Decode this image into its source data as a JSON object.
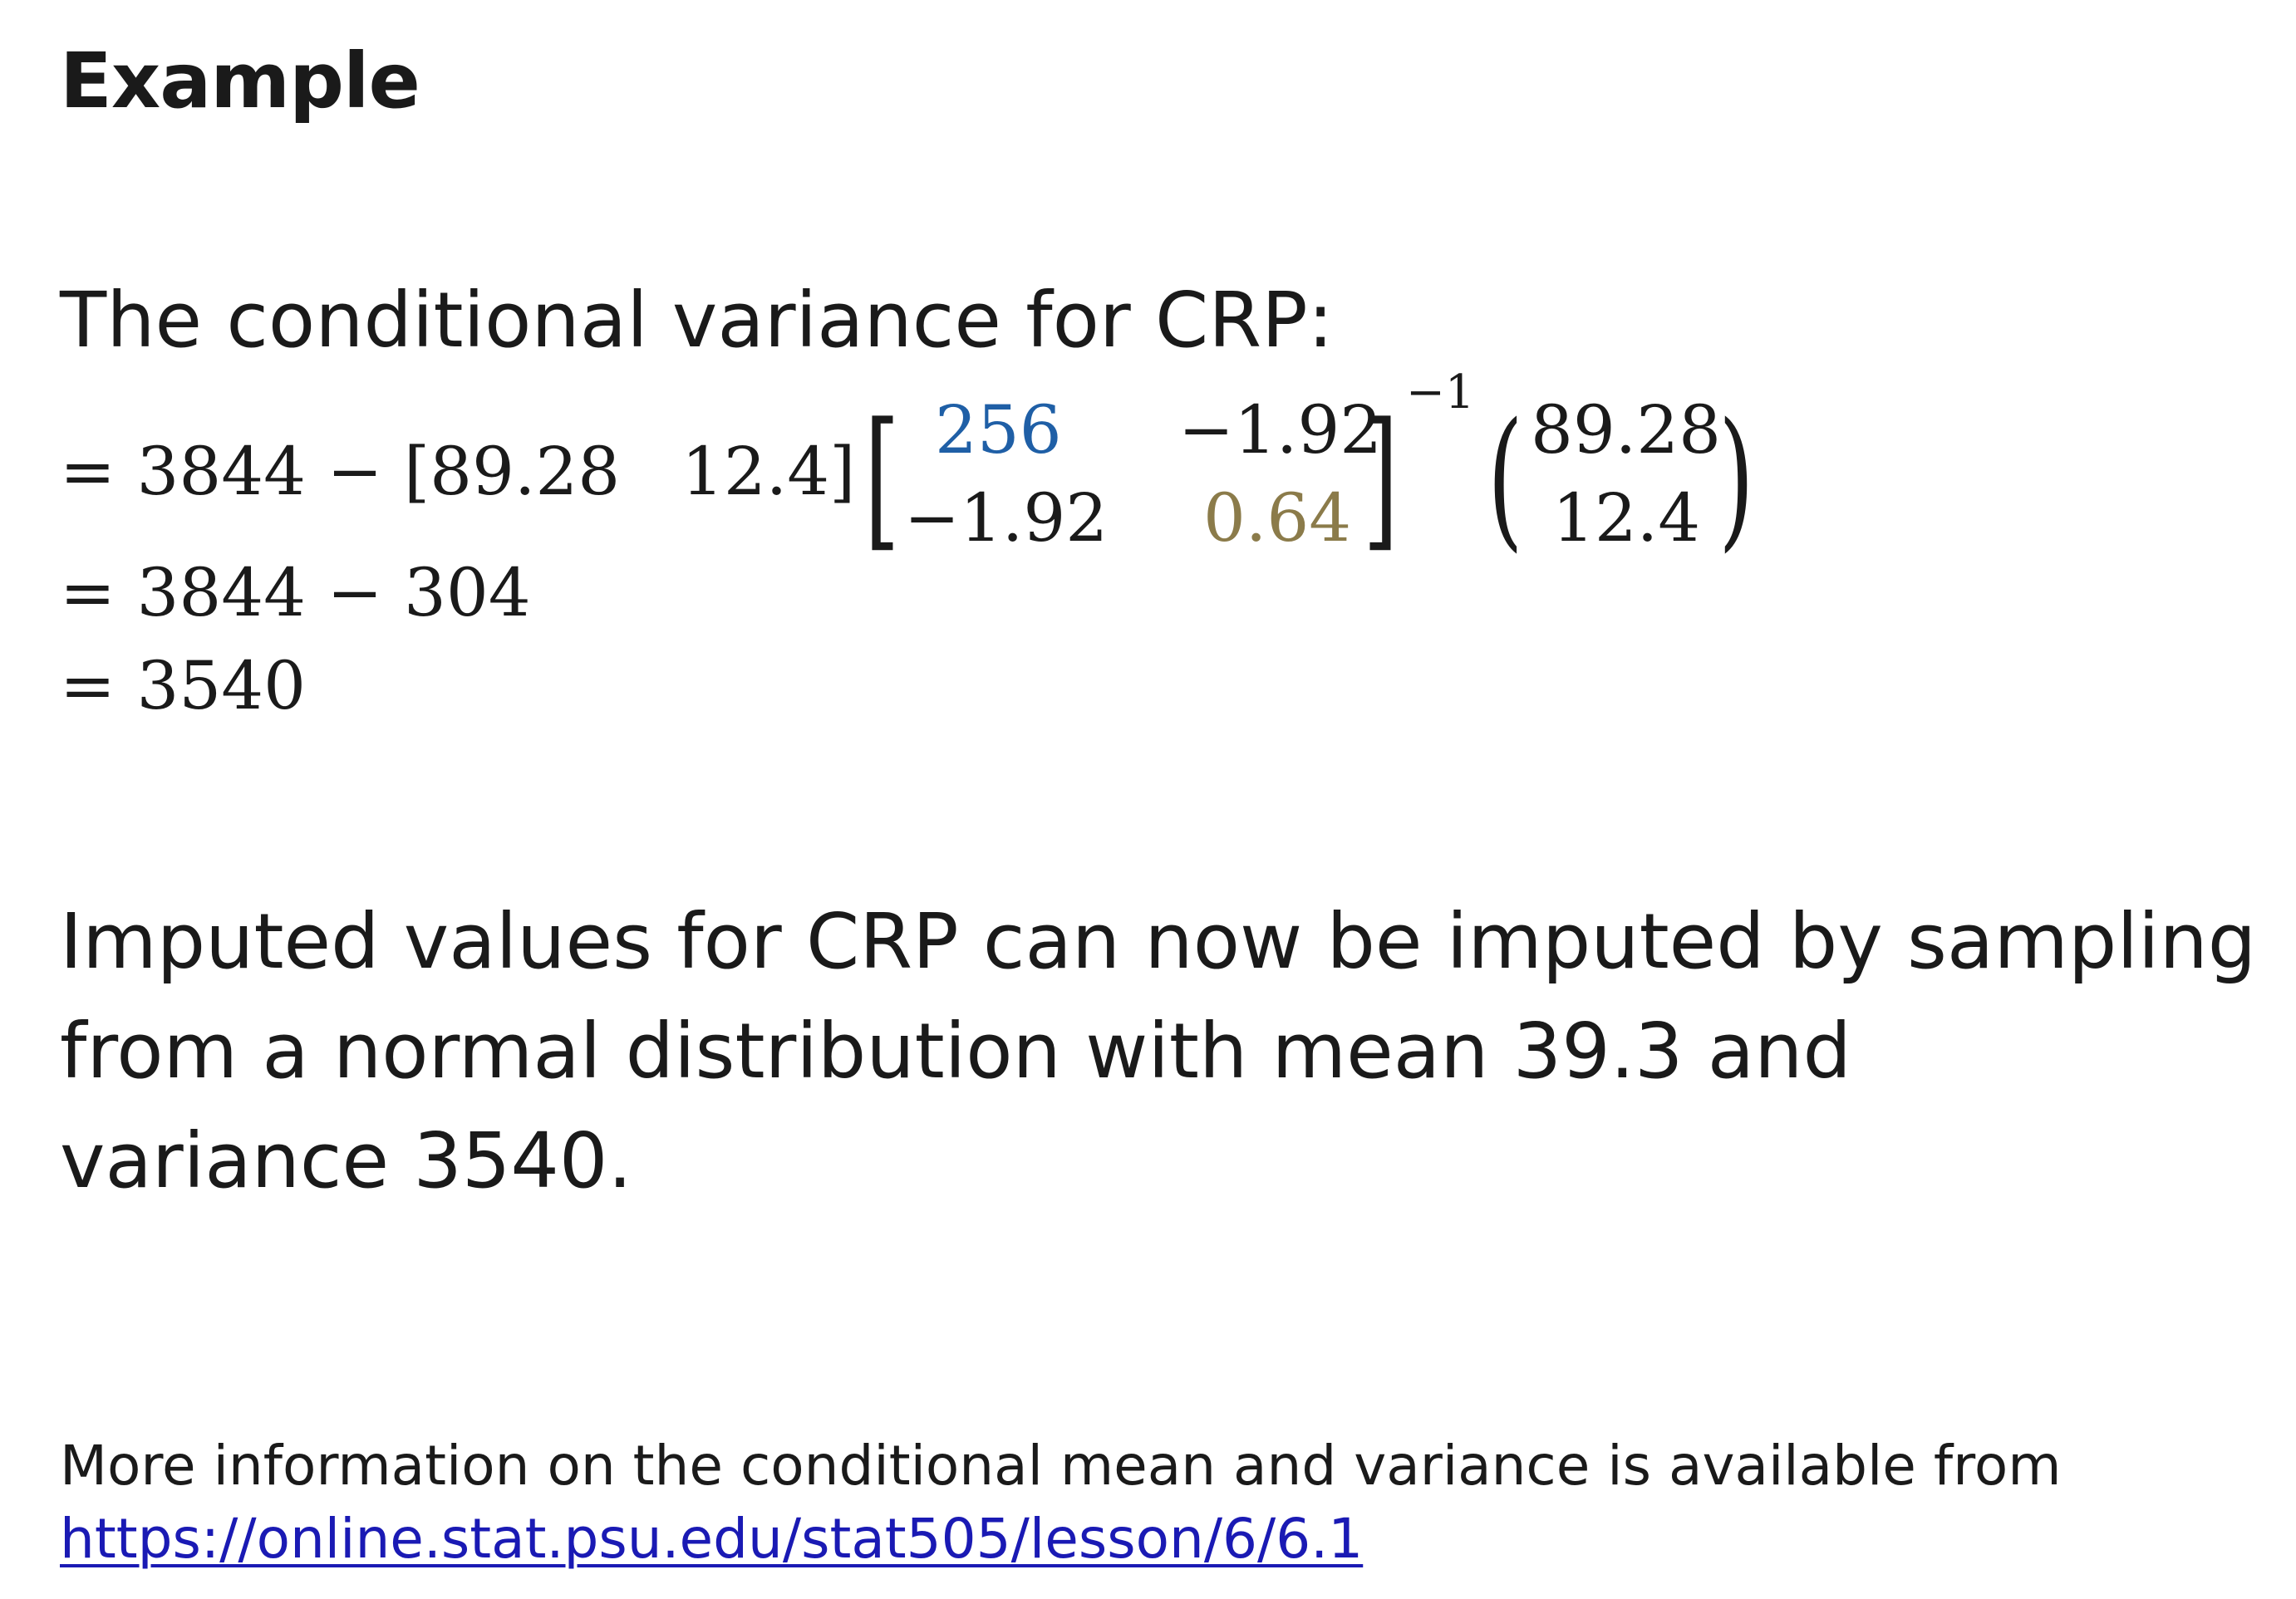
{
  "heading": "Example",
  "intro": "The conditional variance for CRP:",
  "equation": {
    "line1_lead": "= 3844 − [89.28",
    "line1_b": "12.4]",
    "matrix": {
      "a11": "256",
      "a12": "−1.92",
      "a21": "−1.92",
      "a22": "0.64",
      "exponent": "−1",
      "a11_color": "#1f5fa6",
      "a22_color": "#8b7b4a"
    },
    "vector": {
      "v1": "89.28",
      "v2": "12.4"
    },
    "line2": "= 3844 − 304",
    "line3": "= 3540"
  },
  "paragraph": {
    "line1": "Imputed values for CRP can now be imputed by sampling",
    "line2": "from a normal distribution with mean 39.3 and",
    "line3": "variance 3540."
  },
  "note": "More information on the conditional mean and variance is available from",
  "link": "https://online.stat.psu.edu/stat505/lesson/6/6.1"
}
